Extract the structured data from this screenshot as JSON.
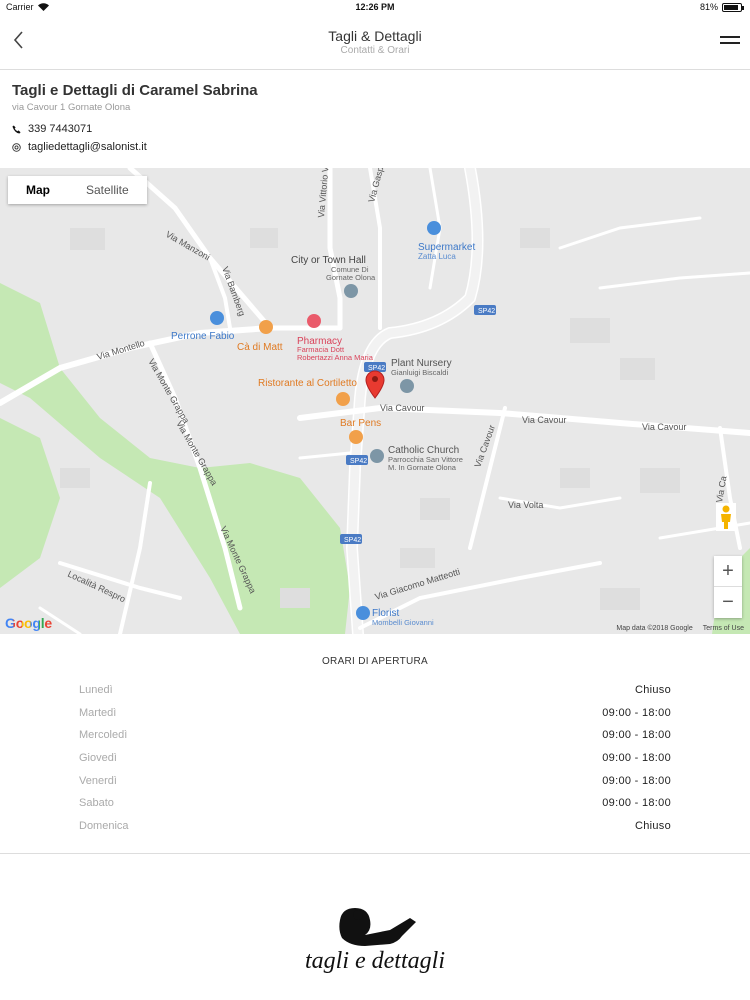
{
  "status_bar": {
    "carrier": "Carrier",
    "time": "12:26 PM",
    "battery": "81%",
    "battery_level": 0.81
  },
  "nav": {
    "title": "Tagli & Dettagli",
    "subtitle": "Contatti & Orari"
  },
  "shop": {
    "name": "Tagli e Dettagli di Caramel Sabrina",
    "address": "via Cavour 1 Gornate Olona",
    "phone": "339 7443071",
    "email": "tagliedettagli@salonist.it"
  },
  "map": {
    "tabs": [
      "Map",
      "Satellite"
    ],
    "active_tab": "Map",
    "labels": {
      "city_hall": "City or Town Hall",
      "city_hall_sub1": "Comune Di",
      "city_hall_sub2": "Gornate Olona",
      "supermarket": "Supermarket",
      "supermarket_sub": "Zatta Luca",
      "perrone": "Perrone Fabio",
      "ca_di_matt": "Cà di Matt",
      "pharmacy": "Pharmacy",
      "pharmacy_sub1": "Farmacia Dott",
      "pharmacy_sub2": "Robertazzi Anna Maria",
      "plant_nursery": "Plant Nursery",
      "plant_nursery_sub": "Gianluigi Biscaldi",
      "ristorante": "Ristorante al Cortiletto",
      "bar_pens": "Bar Pens",
      "church": "Catholic Church",
      "church_sub1": "Parrocchia San Vittore",
      "church_sub2": "M. In Gornate Olona",
      "florist": "Florist",
      "florist_sub": "Mombelli Giovanni",
      "via_cavour": "Via Cavour",
      "via_montello": "Via Montello",
      "via_manzoni": "Via Manzoni",
      "via_bamberg": "Via Bamberg",
      "via_vittorio": "Via Vittorio Ve",
      "via_gasp": "Via Gasp",
      "via_monte_grappa": "Via Monte Grappa",
      "via_volta": "Via Volta",
      "via_mattei": "Via Giacomo Matteotti",
      "localita": "Località Respro",
      "via_ca": "Via Ca",
      "sp42": "SP42"
    },
    "zoom_in": "+",
    "zoom_out": "−",
    "google": "Google",
    "map_data": "Map data ©2018 Google",
    "terms": "Terms of Use"
  },
  "hours": {
    "title": "ORARI DI APERTURA",
    "days": [
      {
        "day": "Lunedì",
        "time": "Chiuso"
      },
      {
        "day": "Martedì",
        "time": "09:00 - 18:00"
      },
      {
        "day": "Mercoledì",
        "time": "09:00 - 18:00"
      },
      {
        "day": "Giovedì",
        "time": "09:00 - 18:00"
      },
      {
        "day": "Venerdì",
        "time": "09:00 - 18:00"
      },
      {
        "day": "Sabato",
        "time": "09:00 - 18:00"
      },
      {
        "day": "Domenica",
        "time": "Chiuso"
      }
    ]
  },
  "logo": {
    "text": "tagli e dettagli"
  }
}
